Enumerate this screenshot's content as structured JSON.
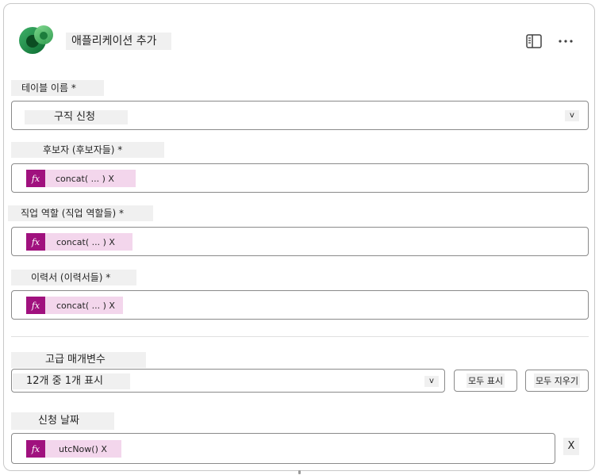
{
  "header": {
    "title": "애플리케이션 추가",
    "panel_icon": "side-panel-icon",
    "more_icon": "more-options-icon"
  },
  "fields": {
    "table_name": {
      "label": "테이블 이름 *",
      "value": "구직 신청",
      "chevron": "v"
    },
    "candidate": {
      "label": "후보자 (후보자들) *",
      "fx": "fx",
      "formula": "concat( ... ) X"
    },
    "job_role": {
      "label": "직업 역할 (직업 역할들) *",
      "fx": "fx",
      "formula": "concat( ... ) X"
    },
    "resume": {
      "label": "이력서 (이력서들) *",
      "fx": "fx",
      "formula": "concat( ... ) X"
    }
  },
  "advanced": {
    "label": "고급 매개변수",
    "select_value": "12개 중 1개 표시",
    "chevron": "v",
    "show_all": "모두 표시",
    "clear_all": "모두 지우기"
  },
  "apply_date": {
    "label": "신청 날짜",
    "fx": "fx",
    "formula": "utcNow() X",
    "remove": "X"
  },
  "colors": {
    "fx_badge": "#a0117e",
    "fx_chip": "#f3d6ec",
    "label_bg": "#f0f0f0"
  }
}
